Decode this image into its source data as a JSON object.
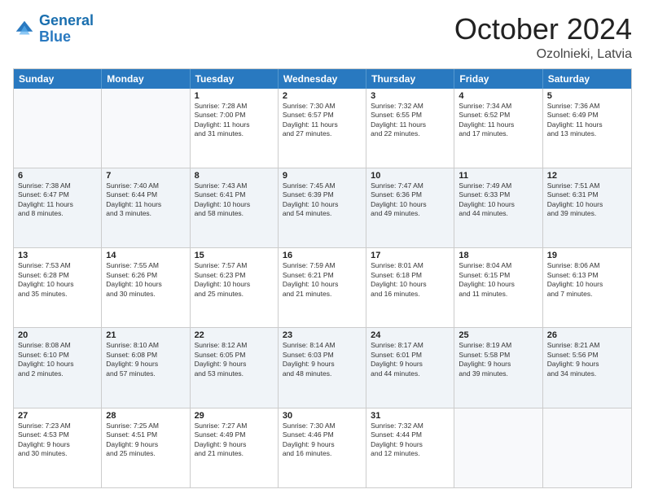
{
  "header": {
    "logo_line1": "General",
    "logo_line2": "Blue",
    "month": "October 2024",
    "location": "Ozolnieki, Latvia"
  },
  "days_of_week": [
    "Sunday",
    "Monday",
    "Tuesday",
    "Wednesday",
    "Thursday",
    "Friday",
    "Saturday"
  ],
  "rows": [
    [
      {
        "day": "",
        "info": ""
      },
      {
        "day": "",
        "info": ""
      },
      {
        "day": "1",
        "info": "Sunrise: 7:28 AM\nSunset: 7:00 PM\nDaylight: 11 hours\nand 31 minutes."
      },
      {
        "day": "2",
        "info": "Sunrise: 7:30 AM\nSunset: 6:57 PM\nDaylight: 11 hours\nand 27 minutes."
      },
      {
        "day": "3",
        "info": "Sunrise: 7:32 AM\nSunset: 6:55 PM\nDaylight: 11 hours\nand 22 minutes."
      },
      {
        "day": "4",
        "info": "Sunrise: 7:34 AM\nSunset: 6:52 PM\nDaylight: 11 hours\nand 17 minutes."
      },
      {
        "day": "5",
        "info": "Sunrise: 7:36 AM\nSunset: 6:49 PM\nDaylight: 11 hours\nand 13 minutes."
      }
    ],
    [
      {
        "day": "6",
        "info": "Sunrise: 7:38 AM\nSunset: 6:47 PM\nDaylight: 11 hours\nand 8 minutes."
      },
      {
        "day": "7",
        "info": "Sunrise: 7:40 AM\nSunset: 6:44 PM\nDaylight: 11 hours\nand 3 minutes."
      },
      {
        "day": "8",
        "info": "Sunrise: 7:43 AM\nSunset: 6:41 PM\nDaylight: 10 hours\nand 58 minutes."
      },
      {
        "day": "9",
        "info": "Sunrise: 7:45 AM\nSunset: 6:39 PM\nDaylight: 10 hours\nand 54 minutes."
      },
      {
        "day": "10",
        "info": "Sunrise: 7:47 AM\nSunset: 6:36 PM\nDaylight: 10 hours\nand 49 minutes."
      },
      {
        "day": "11",
        "info": "Sunrise: 7:49 AM\nSunset: 6:33 PM\nDaylight: 10 hours\nand 44 minutes."
      },
      {
        "day": "12",
        "info": "Sunrise: 7:51 AM\nSunset: 6:31 PM\nDaylight: 10 hours\nand 39 minutes."
      }
    ],
    [
      {
        "day": "13",
        "info": "Sunrise: 7:53 AM\nSunset: 6:28 PM\nDaylight: 10 hours\nand 35 minutes."
      },
      {
        "day": "14",
        "info": "Sunrise: 7:55 AM\nSunset: 6:26 PM\nDaylight: 10 hours\nand 30 minutes."
      },
      {
        "day": "15",
        "info": "Sunrise: 7:57 AM\nSunset: 6:23 PM\nDaylight: 10 hours\nand 25 minutes."
      },
      {
        "day": "16",
        "info": "Sunrise: 7:59 AM\nSunset: 6:21 PM\nDaylight: 10 hours\nand 21 minutes."
      },
      {
        "day": "17",
        "info": "Sunrise: 8:01 AM\nSunset: 6:18 PM\nDaylight: 10 hours\nand 16 minutes."
      },
      {
        "day": "18",
        "info": "Sunrise: 8:04 AM\nSunset: 6:15 PM\nDaylight: 10 hours\nand 11 minutes."
      },
      {
        "day": "19",
        "info": "Sunrise: 8:06 AM\nSunset: 6:13 PM\nDaylight: 10 hours\nand 7 minutes."
      }
    ],
    [
      {
        "day": "20",
        "info": "Sunrise: 8:08 AM\nSunset: 6:10 PM\nDaylight: 10 hours\nand 2 minutes."
      },
      {
        "day": "21",
        "info": "Sunrise: 8:10 AM\nSunset: 6:08 PM\nDaylight: 9 hours\nand 57 minutes."
      },
      {
        "day": "22",
        "info": "Sunrise: 8:12 AM\nSunset: 6:05 PM\nDaylight: 9 hours\nand 53 minutes."
      },
      {
        "day": "23",
        "info": "Sunrise: 8:14 AM\nSunset: 6:03 PM\nDaylight: 9 hours\nand 48 minutes."
      },
      {
        "day": "24",
        "info": "Sunrise: 8:17 AM\nSunset: 6:01 PM\nDaylight: 9 hours\nand 44 minutes."
      },
      {
        "day": "25",
        "info": "Sunrise: 8:19 AM\nSunset: 5:58 PM\nDaylight: 9 hours\nand 39 minutes."
      },
      {
        "day": "26",
        "info": "Sunrise: 8:21 AM\nSunset: 5:56 PM\nDaylight: 9 hours\nand 34 minutes."
      }
    ],
    [
      {
        "day": "27",
        "info": "Sunrise: 7:23 AM\nSunset: 4:53 PM\nDaylight: 9 hours\nand 30 minutes."
      },
      {
        "day": "28",
        "info": "Sunrise: 7:25 AM\nSunset: 4:51 PM\nDaylight: 9 hours\nand 25 minutes."
      },
      {
        "day": "29",
        "info": "Sunrise: 7:27 AM\nSunset: 4:49 PM\nDaylight: 9 hours\nand 21 minutes."
      },
      {
        "day": "30",
        "info": "Sunrise: 7:30 AM\nSunset: 4:46 PM\nDaylight: 9 hours\nand 16 minutes."
      },
      {
        "day": "31",
        "info": "Sunrise: 7:32 AM\nSunset: 4:44 PM\nDaylight: 9 hours\nand 12 minutes."
      },
      {
        "day": "",
        "info": ""
      },
      {
        "day": "",
        "info": ""
      }
    ]
  ]
}
